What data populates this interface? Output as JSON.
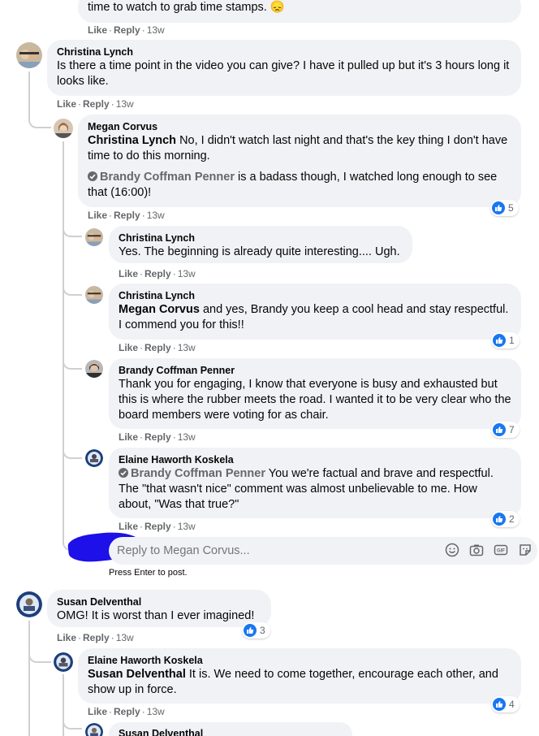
{
  "actions": {
    "like": "Like",
    "reply": "Reply"
  },
  "comments": [
    {
      "id": "c0",
      "text": "time to watch to grab time stamps. 😞",
      "time": "13w"
    },
    {
      "id": "c1",
      "author": "Christina Lynch",
      "text": "Is there a time point in the video you can give? I have it pulled up but it's 3 hours long it looks like.",
      "time": "13w"
    },
    {
      "id": "c2",
      "author": "Megan Corvus",
      "mention": "Christina Lynch",
      "text": " No, I didn't watch last night and that's the key thing I don't have time to do this morning.",
      "mention2": "Brandy Coffman Penner",
      "text2": " is a badass though, I watched long enough to see that (16:00)!",
      "time": "13w",
      "reactions": "5"
    },
    {
      "id": "c3",
      "author": "Christina Lynch",
      "text": "Yes. The beginning is already quite interesting.... Ugh.",
      "time": "13w"
    },
    {
      "id": "c4",
      "author": "Christina Lynch",
      "mention": "Megan Corvus",
      "text": " and yes, Brandy you keep a cool head and stay respectful. I commend you for this!!",
      "time": "13w",
      "reactions": "1"
    },
    {
      "id": "c5",
      "author": "Brandy Coffman Penner",
      "text": "Thank you for engaging, I know that everyone is busy and exhausted but this is where the rubber meets the road. I wanted it to be very clear who the board members were voting for as chair.",
      "time": "13w",
      "reactions": "7"
    },
    {
      "id": "c6",
      "author": "Elaine Haworth Koskela",
      "mention": "Brandy Coffman Penner",
      "text": " You we're factual and brave and respectful. The \"that wasn't nice\" comment was almost unbelievable to me. How about, \"Was that true?\"",
      "time": "13w",
      "reactions": "2"
    },
    {
      "id": "c7",
      "author": "Susan Delventhal",
      "text": "OMG! It is worst than I ever imagined!",
      "time": "13w",
      "reactions": "3"
    },
    {
      "id": "c8",
      "author": "Elaine Haworth Koskela",
      "mention": "Susan Delventhal",
      "text": " It is. We need to come together, encourage each other, and show up in force.",
      "time": "13w",
      "reactions": "4"
    },
    {
      "id": "c9",
      "author": "Susan Delventhal"
    }
  ],
  "reply_box": {
    "placeholder": "Reply to Megan Corvus...",
    "hint": "Press Enter to post."
  },
  "colors": {
    "bubble": "#f0f2f5",
    "like_blue": "#1877f2",
    "muted": "#65676b"
  }
}
